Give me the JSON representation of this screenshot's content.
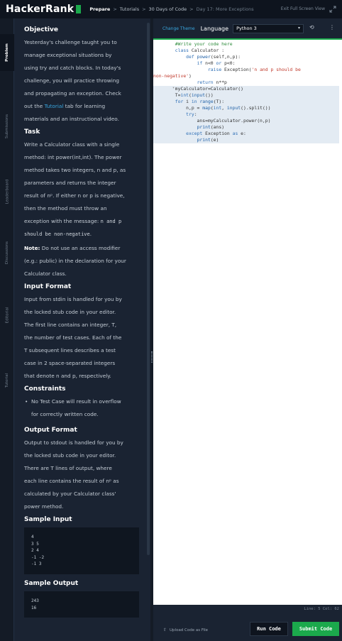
{
  "brand": {
    "name": "HackerRank",
    "accent": "#1ba94c"
  },
  "breadcrumbs": [
    "Prepare",
    "Tutorials",
    "30 Days of Code",
    "Day 17: More Exceptions"
  ],
  "breadcrumb_sep": ">",
  "exit_label": "Exit Full Screen View",
  "vtabs": [
    "Problem",
    "Submissions",
    "Leaderboard",
    "Discussions",
    "Editorial",
    "Tutorial"
  ],
  "problem": {
    "objective_title": "Objective",
    "objective_lines": [
      "Yesterday's challenge taught you to",
      "manage exceptional situations by",
      "using try and catch blocks. In today's",
      "challenge, you will practice throwing",
      "and propagating an exception. Check"
    ],
    "objective_link_pre": "out the ",
    "objective_link": "Tutorial",
    "objective_link_post": " tab for learning",
    "objective_last": "materials and an instructional video.",
    "task_title": "Task",
    "task_lines": [
      "Write a Calculator class with a single",
      "method: int power(int,int). The power",
      "method takes two integers, n and p, as",
      "parameters and returns the integer",
      "result of nᵖ. If either n or p is negative,",
      "then the method must throw an"
    ],
    "task_msg_pre": "exception with the message: ",
    "task_msg_code1": "n and p",
    "task_msg_code2": "should be non-negative",
    "task_msg_end": ".",
    "note_label": "Note:",
    "note_lines": [
      " Do not use an access modifier",
      "(e.g.: public) in the declaration for your",
      "Calculator class."
    ],
    "input_title": "Input Format",
    "input_lines": [
      "Input from stdin is handled for you by",
      "the locked stub code in your editor.",
      "The first line contains an integer, T,",
      "the number of test cases. Each of the",
      "T subsequent lines describes a test",
      "case in 2 space-separated integers",
      "that denote n and p, respectively."
    ],
    "constraints_title": "Constraints",
    "constraint_lines": [
      "No Test Case will result in overflow",
      "for correctly written code."
    ],
    "output_title": "Output Format",
    "output_lines": [
      "Output to stdout is handled for you by",
      "the locked stub code in your editor.",
      "There are T lines of output, where",
      "each line contains the result of nᵖ as",
      "calculated by your Calculator class'",
      "power method."
    ],
    "sample_input_title": "Sample Input",
    "sample_input": "4\n3 5\n2 4\n-1 -2\n-1 3",
    "sample_output_title": "Sample Output",
    "sample_output": "243\n16"
  },
  "editor": {
    "change_theme": "Change Theme",
    "language_label": "Language",
    "language_value": "Python 3",
    "status": "Line: 5 Col: 62",
    "upload_label": "Upload Code as File",
    "run_label": "Run Code",
    "submit_label": "Submit Code"
  }
}
